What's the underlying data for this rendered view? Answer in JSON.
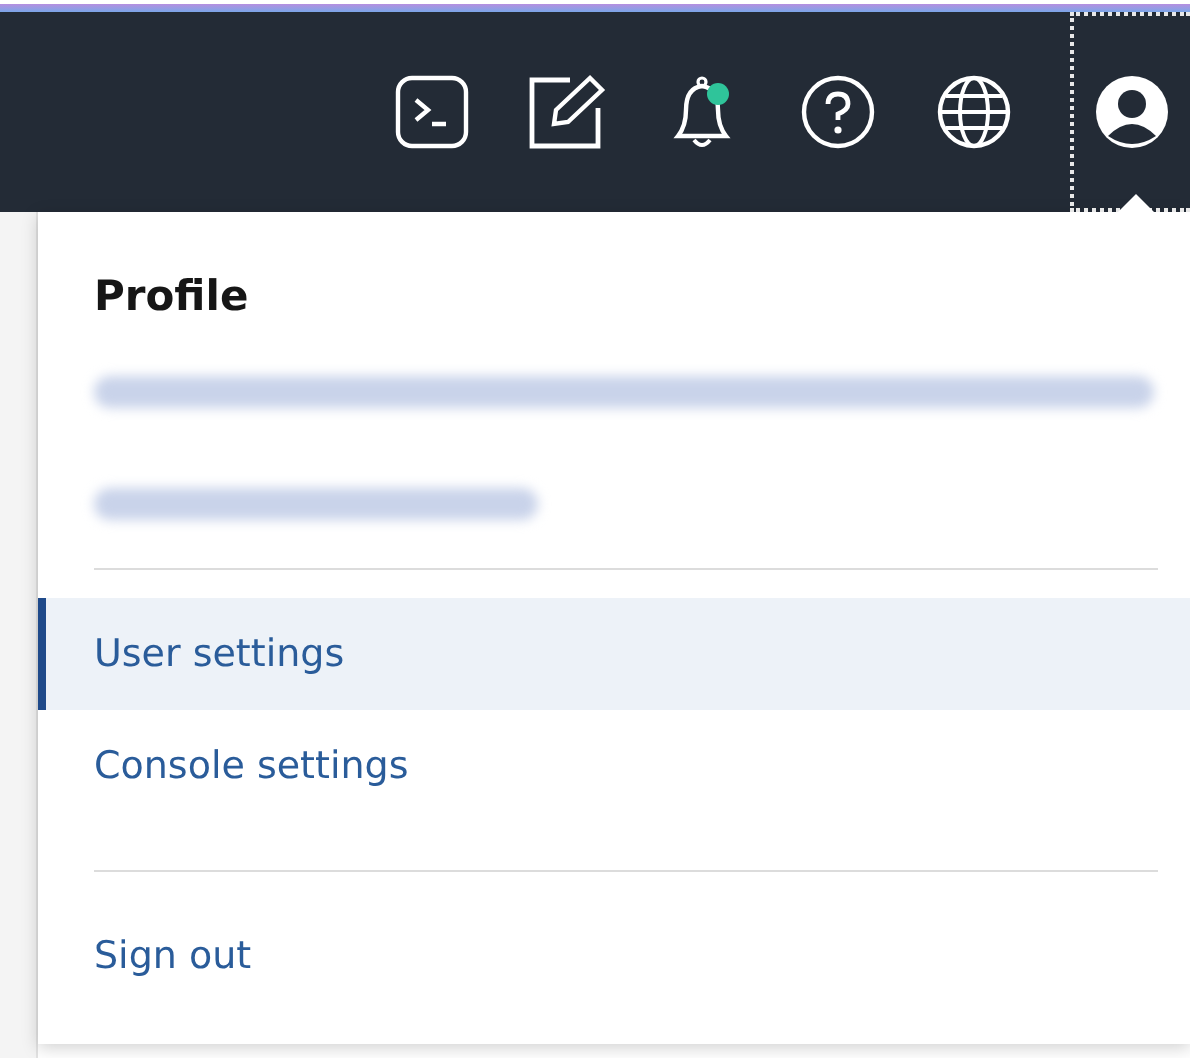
{
  "header": {
    "icons": [
      {
        "kind": "terminal"
      },
      {
        "kind": "edit"
      },
      {
        "kind": "bell",
        "badge": true
      },
      {
        "kind": "help"
      },
      {
        "kind": "globe"
      },
      {
        "kind": "profile",
        "selected": true
      }
    ]
  },
  "profile_menu": {
    "title": "Profile",
    "details": [
      {
        "kind": "blurred"
      },
      {
        "kind": "blurred"
      }
    ],
    "groups": [
      {
        "items": [
          {
            "label": "User settings",
            "selected": true
          },
          {
            "label": "Console settings",
            "selected": false
          }
        ]
      },
      {
        "items": [
          {
            "label": "Sign out",
            "selected": false
          }
        ]
      }
    ]
  }
}
